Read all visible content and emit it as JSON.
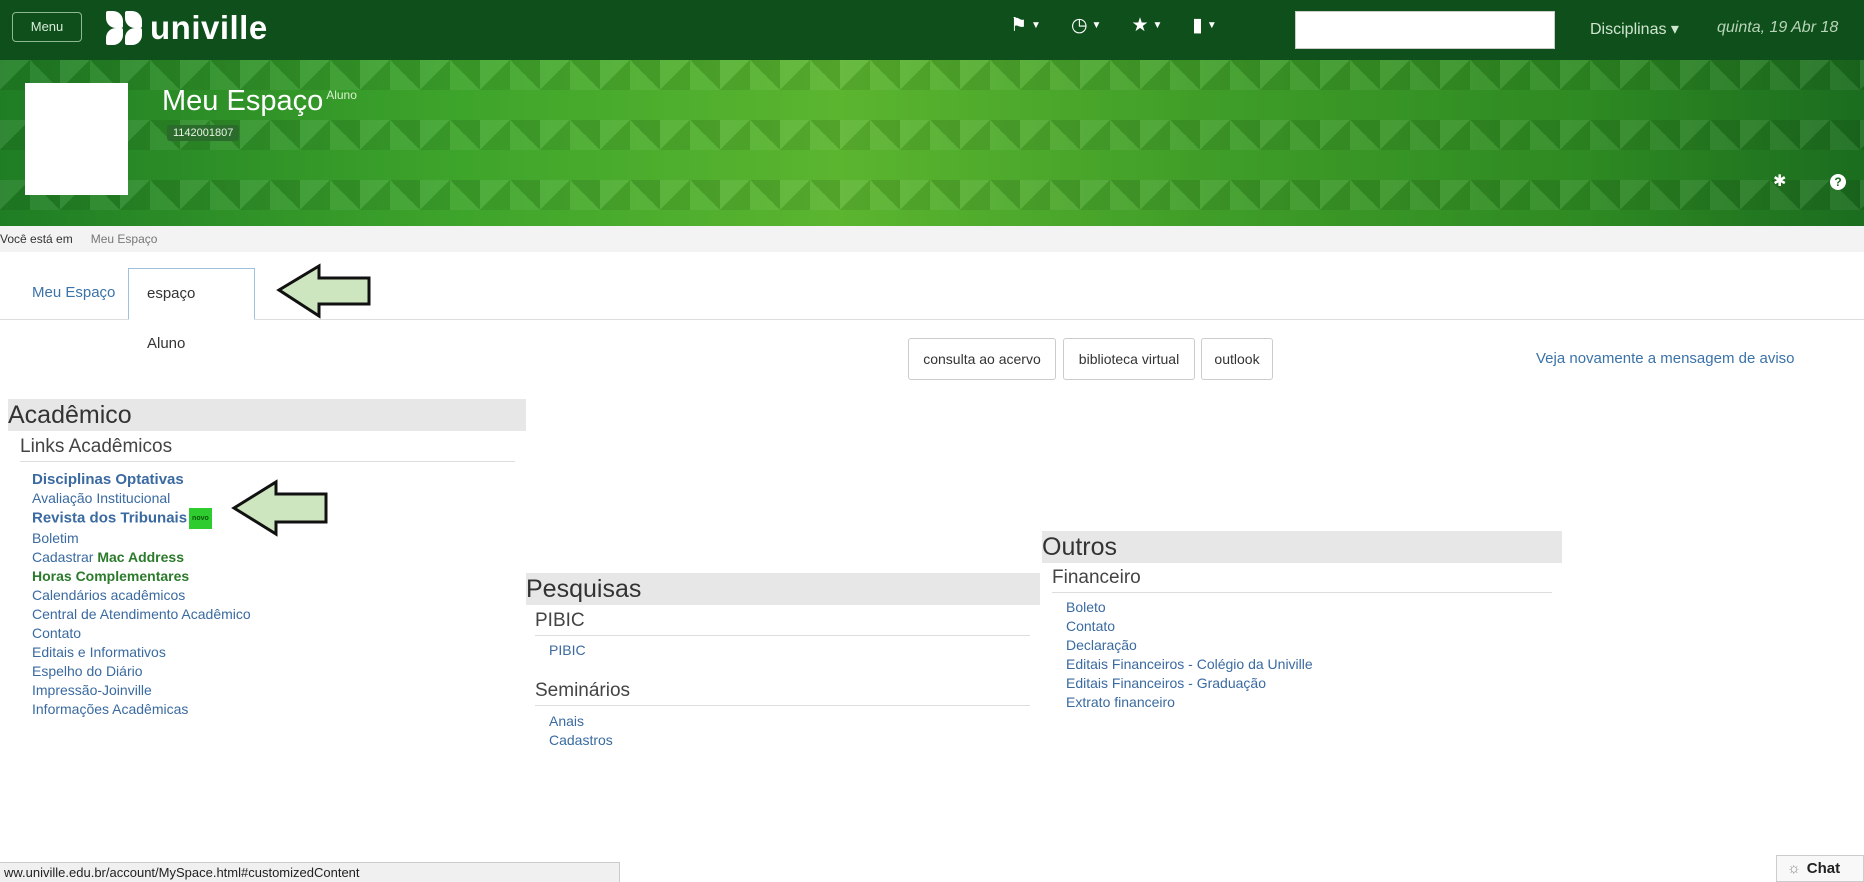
{
  "topnav": {
    "menu_label": "Menu",
    "logo_text": "univille",
    "icons": [
      "tag-icon",
      "clock-icon",
      "star-icon",
      "comment-icon"
    ],
    "disciplinas_label": "Disciplinas ▾",
    "date_text": "quinta, 19 Abr 18"
  },
  "banner": {
    "title": "Meu Espaço",
    "title_sub": "Aluno",
    "user_id": "1142001807"
  },
  "breadcrumb": {
    "prefix": "Você está em",
    "current": "Meu Espaço"
  },
  "tabs": [
    {
      "label": "Meu Espaço",
      "active": false
    },
    {
      "label": "espaço Aluno",
      "active": true
    }
  ],
  "toolbar": {
    "buttons": [
      "consulta ao acervo",
      "biblioteca virtual",
      "outlook"
    ],
    "link": "Veja novamente a mensagem de aviso"
  },
  "academico": {
    "title": "Acadêmico",
    "sub": "Links Acadêmicos",
    "items": [
      "Disciplinas Optativas",
      "Avaliação Institucional",
      "Revista dos Tribunais",
      "Boletim",
      "Cadastrar ",
      "Mac Address",
      "Horas Complementares",
      "Calendários acadêmicos",
      "Central de Atendimento Acadêmico",
      "Contato",
      "Editais e Informativos",
      "Espelho do Diário",
      "Impressão-Joinville",
      "Informações Acadêmicas"
    ],
    "new_badge": "novo"
  },
  "pesquisas": {
    "title": "Pesquisas",
    "sub1": "PIBIC",
    "items1": [
      "PIBIC"
    ],
    "sub2": "Seminários",
    "items2": [
      "Anais",
      "Cadastros"
    ]
  },
  "outros": {
    "title": "Outros",
    "sub": "Financeiro",
    "items": [
      "Boleto",
      "Contato",
      "Declaração",
      "Editais Financeiros - Colégio da Univille",
      "Editais Financeiros - Graduação",
      "Extrato financeiro"
    ]
  },
  "statusbar": {
    "url": "ww.univille.edu.br/account/MySpace.html#customizedContent"
  },
  "chat": {
    "label": "Chat"
  }
}
